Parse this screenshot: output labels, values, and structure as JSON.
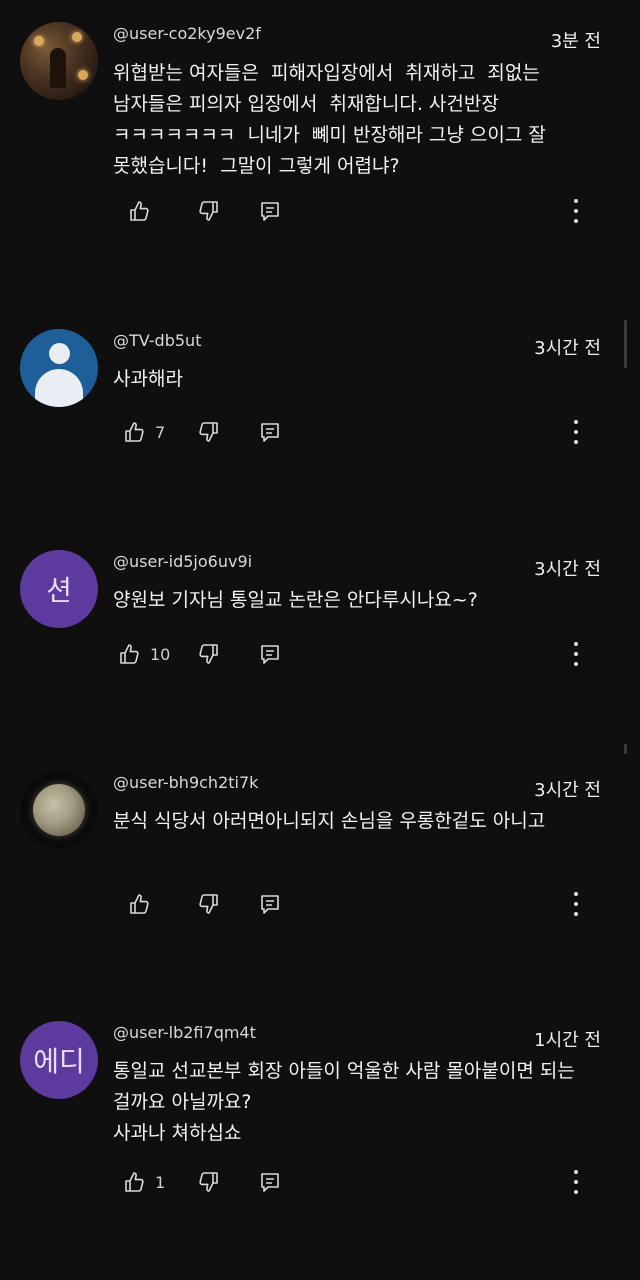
{
  "comments": [
    {
      "username": "@user-co2ky9ev2f",
      "time": "3분 전",
      "avatar": "photo-bar-avatar",
      "text": "위협받는 여자들은  피해자입장에서  취재하고  죄없는 남자들은 피의자 입장에서  취재합니다. 사건반장 ㅋㅋㅋㅋㅋㅋㅋ  니네가  뼤미 반장해라 그냥 으이그 잘 못했습니다!  그말이 그렇게 어렵냐?",
      "likes": ""
    },
    {
      "username": "@TV-db5ut",
      "time": "3시간 전",
      "avatar": "default-avatar",
      "text": "사과해라",
      "likes": "7"
    },
    {
      "username": "@user-id5jo6uv9i",
      "time": "3시간 전",
      "avatar": "letter-avatar",
      "avatar_letter": "션",
      "text": "양원보 기자님 통일교 논란은 안다루시나요~?",
      "likes": "10"
    },
    {
      "username": "@user-bh9ch2ti7k",
      "time": "3시간 전",
      "avatar": "moon-avatar",
      "text": "분식 식당서 아러면아니되지 손님을 우롱한겉도 아니고",
      "likes": ""
    },
    {
      "username": "@user-lb2fi7qm4t",
      "time": "1시간 전",
      "avatar": "letter-avatar",
      "avatar_letter": "에디",
      "text": "통일교 선교본부 회장 아들이 억울한 사람 몰아붙이면 되는 걸까요 아닐까요?\n사과나 쳐하십쇼",
      "likes": "1"
    }
  ],
  "colors": {
    "background": "#0f0f0f",
    "text": "#f1f1f1",
    "icon": "#d9d9d9",
    "letter_avatar": "#5c3a9e",
    "default_avatar": "#1f5f99"
  },
  "icons": [
    "thumbs-up-icon",
    "thumbs-down-icon",
    "reply-icon",
    "more-vert-icon"
  ]
}
